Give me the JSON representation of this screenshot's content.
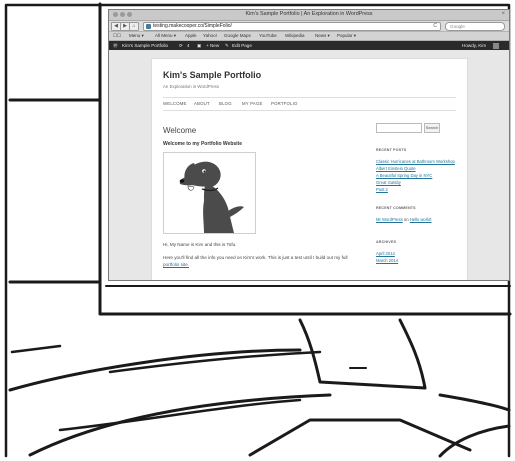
{
  "browser": {
    "window_title": "Kim's Sample Portfolio | An Exploration in WordPress",
    "close_label": "×",
    "nav": {
      "back": "◀",
      "forward": "▶",
      "home": "⌂",
      "add": "+"
    },
    "url": "testing.makecooper.co/SimpleFolio/",
    "reload": "C",
    "search_placeholder": "Google",
    "bookmarks": [
      "Menu ▾",
      "All Menu ▾",
      "Apple",
      "Yahoo!",
      "Google Maps",
      "YouTube",
      "Wikipedia",
      "News ▾",
      "Popular ▾"
    ]
  },
  "admin_bar": {
    "site_name": "Kim's Sample Portfolio",
    "comments_count": "4",
    "new_label": "+ New",
    "edit_label": "Edit Page",
    "howdy": "Howdy, Kim"
  },
  "site": {
    "title": "Kim's Sample Portfolio",
    "description": "An Exploration in WordPress",
    "menu": [
      "WELCOME",
      "ABOUT",
      "BLOG",
      "MY PAGE",
      "PORTFOLIO"
    ]
  },
  "content": {
    "heading": "Welcome",
    "subheading": "Welcome to my Portfolio Website",
    "intro": "Hi, My Name is Kim and this is Tofu.",
    "para": "Here you'll find all the info you need on Kim's work. This is just a test until I build out my full",
    "link": "portfolio site."
  },
  "sidebar": {
    "search_button": "Search",
    "recent_posts_heading": "RECENT POSTS",
    "recent_posts": [
      "Classic Hurricanes at Bathroom Workshop",
      "Albert Einstein Quote",
      "A Beautiful Spring Day in NYC",
      "Great Gatsby",
      "Post 2"
    ],
    "recent_comments_heading": "RECENT COMMENTS",
    "comment_author": "Mr WordPress",
    "comment_on": "on",
    "comment_post": "Hello world!",
    "archives_heading": "ARCHIVES",
    "archives": [
      "April 2014",
      "March 2014"
    ]
  },
  "colors": {
    "link": "#21759b",
    "admin_bar": "#2a2a2a",
    "dog": "#4b4b4b"
  }
}
